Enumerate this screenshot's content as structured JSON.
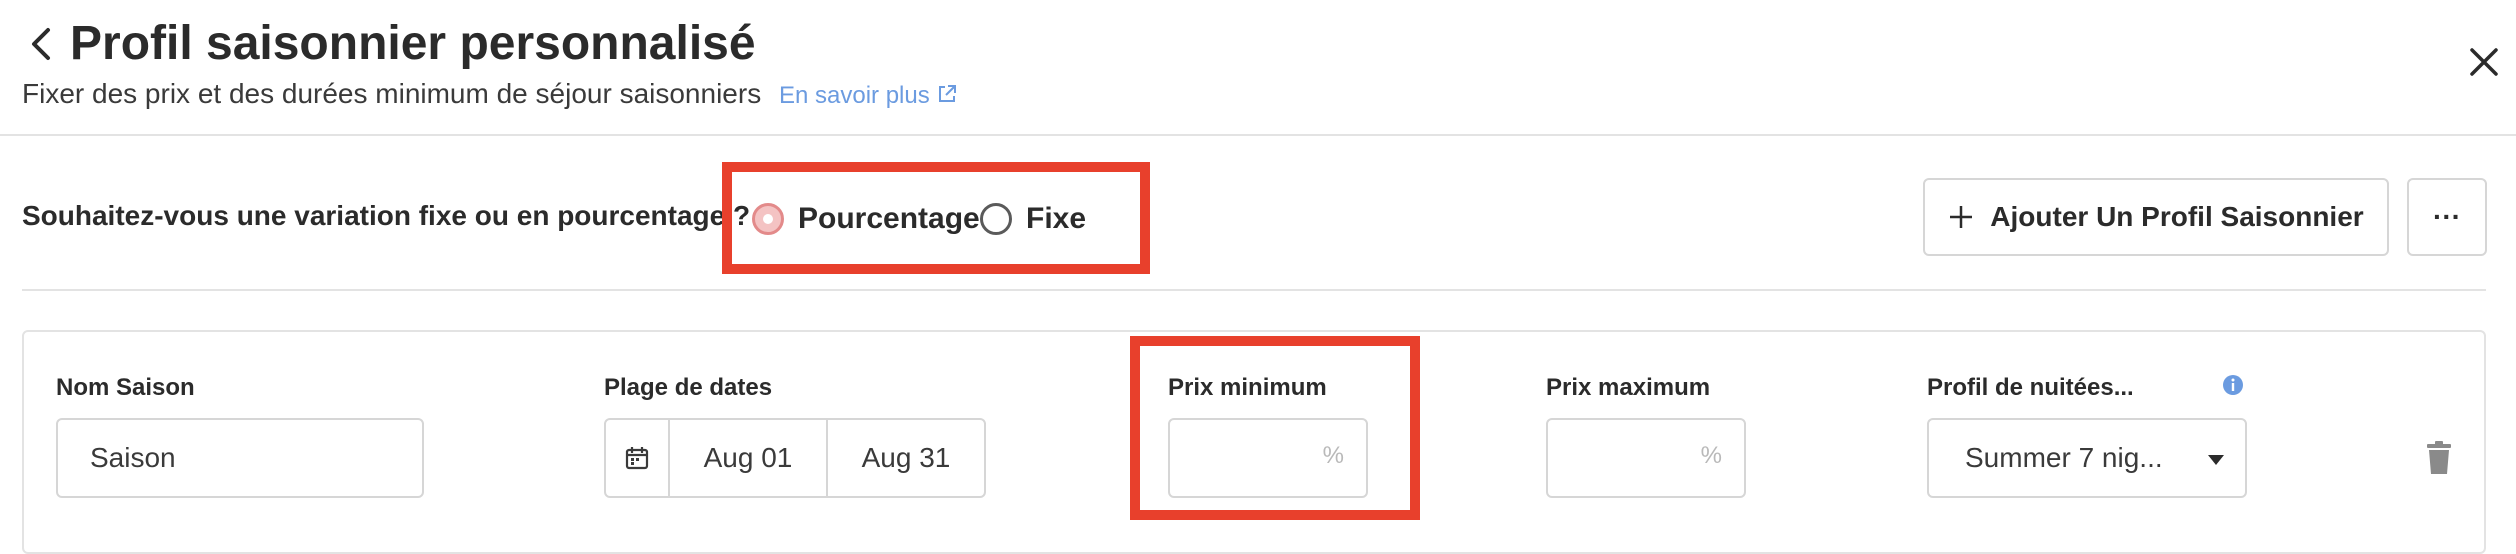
{
  "header": {
    "title": "Profil saisonnier personnalisé",
    "subtitle": "Fixer des prix et des durées minimum de séjour saisonniers",
    "learn_more": "En savoir plus"
  },
  "variation": {
    "question": "Souhaitez-vous une variation fixe ou en pourcentage ?",
    "options": [
      {
        "label": "Pourcentage",
        "selected": true
      },
      {
        "label": "Fixe",
        "selected": false
      }
    ],
    "add_button": "Ajouter Un Profil Saisonnier",
    "more_button": "···"
  },
  "season": {
    "name_label": "Nom Saison",
    "name_value": "Saison",
    "date_label": "Plage de dates",
    "date_start": "Aug 01",
    "date_end": "Aug 31",
    "min_price_label": "Prix minimum",
    "min_price_value": "",
    "max_price_label": "Prix maximum",
    "max_price_value": "",
    "percent_suffix": "%",
    "nights_label": "Profil de nuitées...",
    "nights_value": "Summer 7 nig..."
  },
  "colors": {
    "highlight": "#e8402c",
    "radio_selected": "#e38a8a",
    "link": "#6b9be0",
    "info": "#6b9be0"
  },
  "icons": [
    "chevron-left-icon",
    "close-icon",
    "external-link-icon",
    "plus-icon",
    "calendar-icon",
    "info-icon",
    "caret-down-icon",
    "trash-icon"
  ]
}
